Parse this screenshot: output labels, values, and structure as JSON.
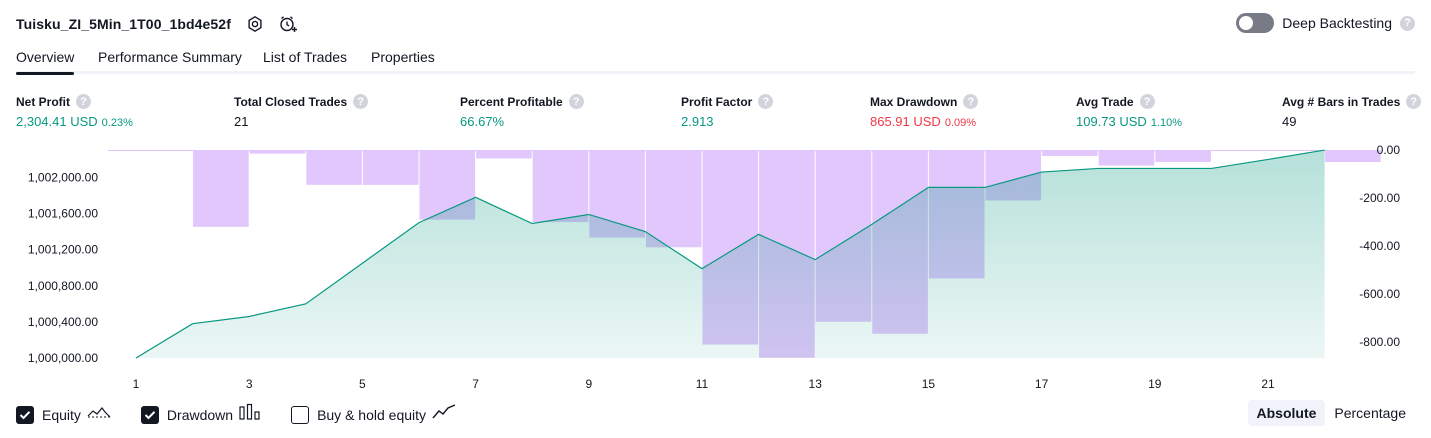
{
  "header": {
    "strategy_name": "Tuisku_ZI_5Min_1T00_1bd4e52f",
    "deep_backtesting_label": "Deep Backtesting",
    "help_glyph": "?"
  },
  "tabs": [
    {
      "label": "Overview",
      "active": true
    },
    {
      "label": "Performance Summary",
      "active": false
    },
    {
      "label": "List of Trades",
      "active": false
    },
    {
      "label": "Properties",
      "active": false
    }
  ],
  "stats": [
    {
      "label": "Net Profit",
      "value": "2,304.41 USD",
      "pct": "0.23%",
      "color": "#089981"
    },
    {
      "label": "Total Closed Trades",
      "value": "21",
      "pct": "",
      "color": "#131722"
    },
    {
      "label": "Percent Profitable",
      "value": "66.67%",
      "pct": "",
      "color": "#089981"
    },
    {
      "label": "Profit Factor",
      "value": "2.913",
      "pct": "",
      "color": "#089981"
    },
    {
      "label": "Max Drawdown",
      "value": "865.91 USD",
      "pct": "0.09%",
      "color": "#f23645"
    },
    {
      "label": "Avg Trade",
      "value": "109.73 USD",
      "pct": "1.10%",
      "color": "#089981"
    },
    {
      "label": "Avg # Bars in Trades",
      "value": "49",
      "pct": "",
      "color": "#131722"
    }
  ],
  "chart_data": {
    "type": "line",
    "x": [
      1,
      2,
      3,
      4,
      5,
      6,
      7,
      8,
      9,
      10,
      11,
      12,
      13,
      14,
      15,
      16,
      17,
      18,
      19,
      20,
      21,
      22
    ],
    "x_ticks": [
      "1",
      "3",
      "5",
      "7",
      "9",
      "11",
      "13",
      "15",
      "17",
      "19",
      "21"
    ],
    "y_left_ticks": [
      "1,000,000.00",
      "1,000,400.00",
      "1,000,800.00",
      "1,001,200.00",
      "1,001,600.00",
      "1,002,000.00"
    ],
    "y_right_ticks": [
      "0.00",
      "-200.00",
      "-400.00",
      "-600.00",
      "-800.00"
    ],
    "ylim_left": [
      1000000,
      1002304.41
    ],
    "ylim_right": [
      -865.91,
      0
    ],
    "series": [
      {
        "name": "Equity",
        "kind": "area-line",
        "color": "#089981",
        "values": [
          1000000,
          1000380,
          1000460,
          1000600,
          1001050,
          1001500,
          1001780,
          1001490,
          1001590,
          1001400,
          1000990,
          1001370,
          1001090,
          1001480,
          1001890,
          1001890,
          1002060,
          1002100,
          1002100,
          1002100,
          1002200,
          1002304
        ]
      },
      {
        "name": "Drawdown",
        "kind": "bar",
        "color": "#e1c7fc",
        "values": [
          0,
          -320,
          -15,
          -145,
          -145,
          -290,
          -35,
          -300,
          -365,
          -405,
          -810,
          -865,
          -715,
          -765,
          -535,
          -210,
          -25,
          -65,
          -50,
          0,
          0,
          -50
        ]
      }
    ]
  },
  "legend": [
    {
      "label": "Equity",
      "checked": true,
      "icon": "equity-line-icon"
    },
    {
      "label": "Drawdown",
      "checked": true,
      "icon": "drawdown-bars-icon"
    },
    {
      "label": "Buy & hold equity",
      "checked": false,
      "icon": "buy-hold-line-icon"
    }
  ],
  "mode": {
    "absolute_label": "Absolute",
    "percentage_label": "Percentage",
    "selected": "Absolute"
  }
}
